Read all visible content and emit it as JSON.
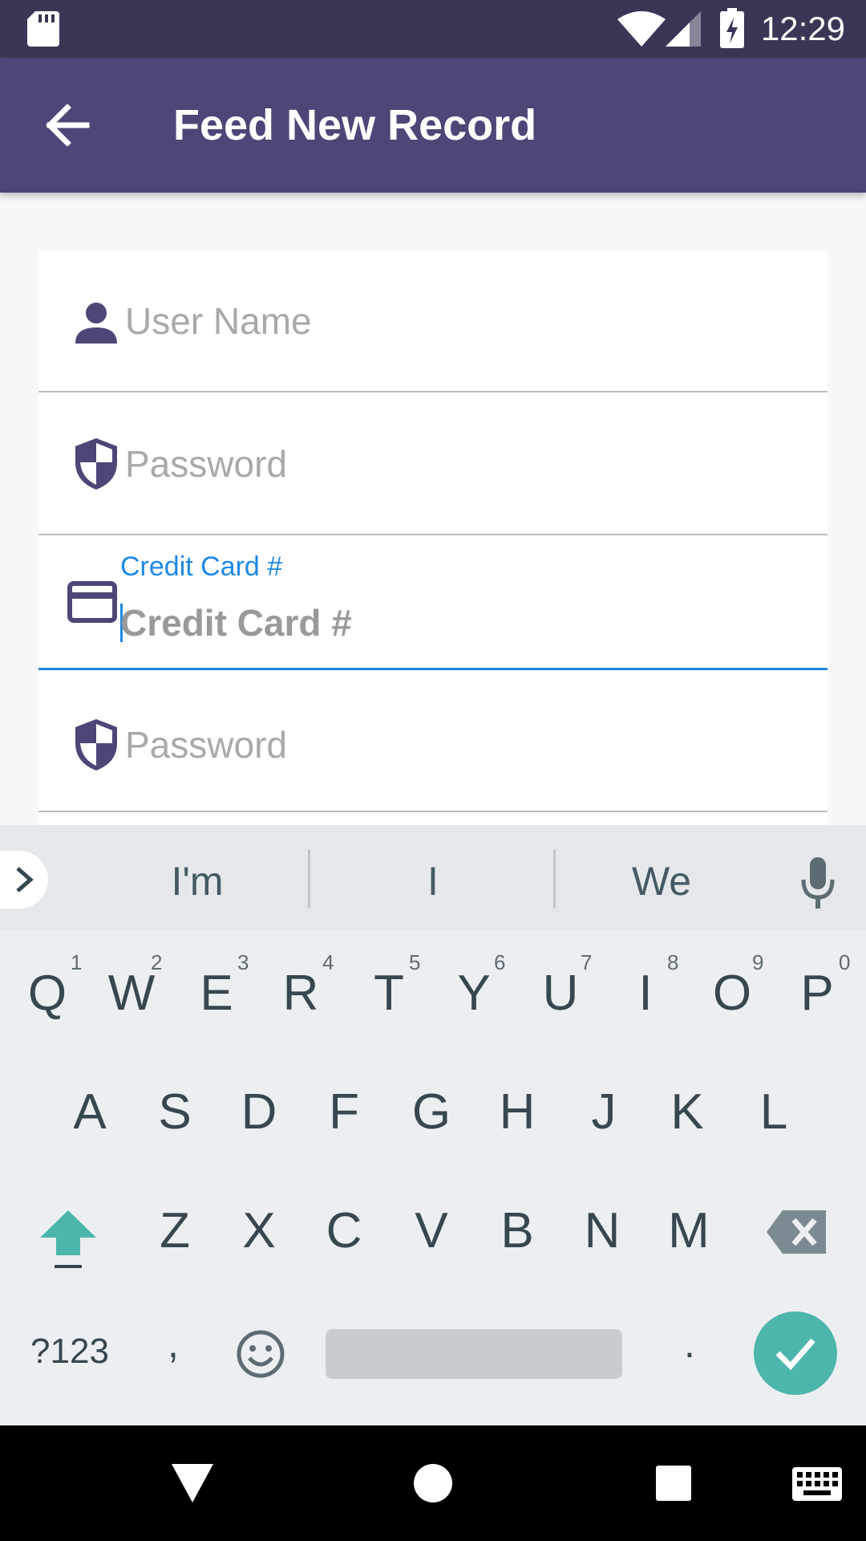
{
  "status_bar": {
    "time": "12:29",
    "icons": [
      "sd-card-icon",
      "wifi-icon",
      "signal-icon",
      "battery-charging-icon"
    ]
  },
  "app_bar": {
    "title": "Feed New Record",
    "back_icon": "arrow-left-icon"
  },
  "form": {
    "fields": [
      {
        "placeholder": "User Name",
        "icon": "person-icon"
      },
      {
        "placeholder": "Password",
        "icon": "shield-icon"
      },
      {
        "floating_label": "Credit Card #",
        "placeholder": "Credit Card #",
        "icon": "credit-card-icon",
        "focused": true
      },
      {
        "placeholder": "Password",
        "icon": "shield-icon"
      }
    ]
  },
  "keyboard": {
    "suggestions": [
      "I'm",
      "I",
      "We"
    ],
    "row1": [
      "Q",
      "W",
      "E",
      "R",
      "T",
      "Y",
      "U",
      "I",
      "O",
      "P"
    ],
    "row1_hints": [
      "1",
      "2",
      "3",
      "4",
      "5",
      "6",
      "7",
      "8",
      "9",
      "0"
    ],
    "row2": [
      "A",
      "S",
      "D",
      "F",
      "G",
      "H",
      "J",
      "K",
      "L"
    ],
    "row3": [
      "Z",
      "X",
      "C",
      "V",
      "B",
      "N",
      "M"
    ],
    "bottom": {
      "symbols": "?123",
      "comma": ",",
      "period": "."
    },
    "accent_color": "#4db6ac"
  },
  "colors": {
    "status_bar": "#3d3556",
    "app_bar": "#4f4577",
    "focus": "#1e88e5"
  }
}
